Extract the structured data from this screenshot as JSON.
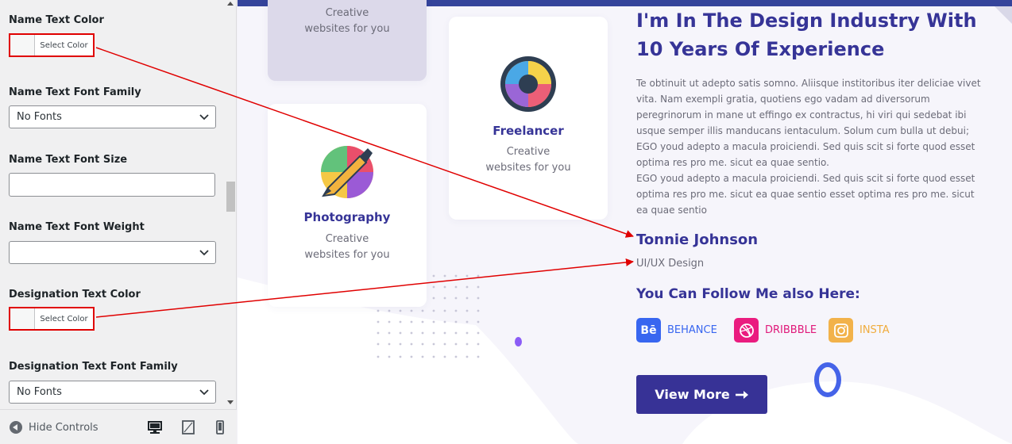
{
  "sidebar": {
    "controls": {
      "name_text_color": {
        "label": "Name Text Color",
        "button": "Select Color"
      },
      "name_font_family": {
        "label": "Name Text Font Family",
        "value": "No Fonts"
      },
      "name_font_size": {
        "label": "Name Text Font Size",
        "value": ""
      },
      "name_font_weight": {
        "label": "Name Text Font Weight",
        "value": ""
      },
      "designation_text_color": {
        "label": "Designation Text Color",
        "button": "Select Color"
      },
      "designation_font_family": {
        "label": "Designation Text Font Family",
        "value": "No Fonts"
      }
    },
    "footer": {
      "hide_controls": "Hide Controls",
      "devices": [
        "desktop-icon",
        "tablet-icon",
        "mobile-icon"
      ]
    }
  },
  "preview": {
    "cards": [
      {
        "title": "",
        "desc_line1": "Creative",
        "desc_line2": "websites for you"
      },
      {
        "title": "Freelancer",
        "desc_line1": "Creative",
        "desc_line2": "websites for you",
        "icon": "aperture-icon"
      },
      {
        "title": "Photography",
        "desc_line1": "Creative",
        "desc_line2": "websites for you",
        "icon": "paint-brush-icon"
      }
    ],
    "heading": "I'm In The Design Industry With 10 Years Of Experience",
    "paragraph_lines": [
      "Te obtinuit ut adepto satis somno. Aliisque institoribus iter deliciae vivet",
      "vita. Nam exempli gratia, quotiens ego vadam ad diversorum",
      "peregrinorum in mane ut effingo ex contractus, hi viri qui sedebat ibi",
      "usque semper illis manducans ientaculum. Solum cum bulla ut debui;",
      "EGO youd adepto a macula proiciendi. Sed quis scit si forte quod esset",
      "optima res pro me. sicut ea quae sentio.",
      "EGO youd adepto a macula proiciendi. Sed quis scit si forte quod esset",
      "optima res pro me. sicut ea quae sentio esset optima res pro me. sicut",
      "ea quae sentio"
    ],
    "name": "Tonnie Johnson",
    "designation": "UI/UX Design",
    "follow_heading": "You Can Follow Me also Here:",
    "social": [
      {
        "label": "BEHANCE",
        "icon_text": "Bē",
        "color": "#3866f0",
        "text_color": "#3866f0"
      },
      {
        "label": "DRIBBBLE",
        "icon_text": "",
        "color": "#ea1c7f",
        "text_color": "#e0197a"
      },
      {
        "label": "INSTA",
        "icon_text": "",
        "color": "#f2b24a",
        "text_color": "#f0ac3d"
      }
    ],
    "view_more": "View More"
  },
  "colors": {
    "accent": "#363497",
    "annotation": "#e00000",
    "topbar": "#35449b"
  }
}
